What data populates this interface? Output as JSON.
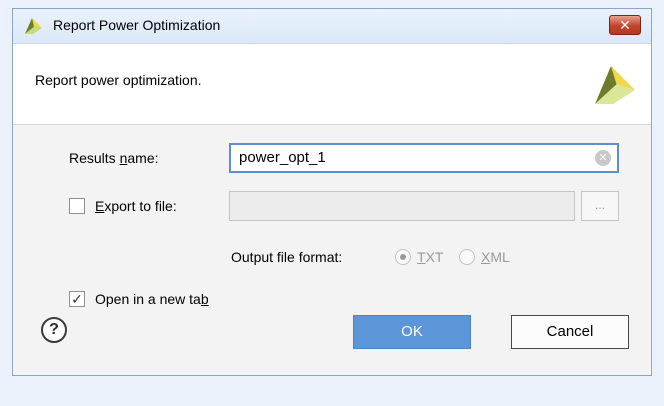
{
  "window": {
    "title": "Report Power Optimization",
    "close_glyph": "✕"
  },
  "header": {
    "description": "Report power optimization."
  },
  "form": {
    "results_name": {
      "label_pre": "Results ",
      "label_mnemonic": "n",
      "label_post": "ame:",
      "value": "power_opt_1"
    },
    "export_to_file": {
      "label_mnemonic": "E",
      "label_post": "xport to file:",
      "checked": false,
      "value": "",
      "browse_label": "..."
    },
    "output_format": {
      "label": "Output file format:",
      "options": [
        {
          "mnemonic": "T",
          "rest": "XT",
          "selected": true
        },
        {
          "mnemonic": "X",
          "rest": "ML",
          "selected": false
        }
      ]
    },
    "open_in_new_tab": {
      "label_pre": "Open in a new ta",
      "label_mnemonic": "b",
      "checked": true,
      "check_glyph": "✓"
    }
  },
  "footer": {
    "help_glyph": "?",
    "ok_label": "OK",
    "cancel_label": "Cancel"
  },
  "colors": {
    "accent": "#5b96d8",
    "logo_light": "#f5e36d",
    "logo_dark": "#6e7d2d"
  },
  "icons": {
    "app_logo": "vivado-logo-icon",
    "close": "close-icon",
    "clear": "clear-input-icon",
    "help": "help-icon"
  }
}
